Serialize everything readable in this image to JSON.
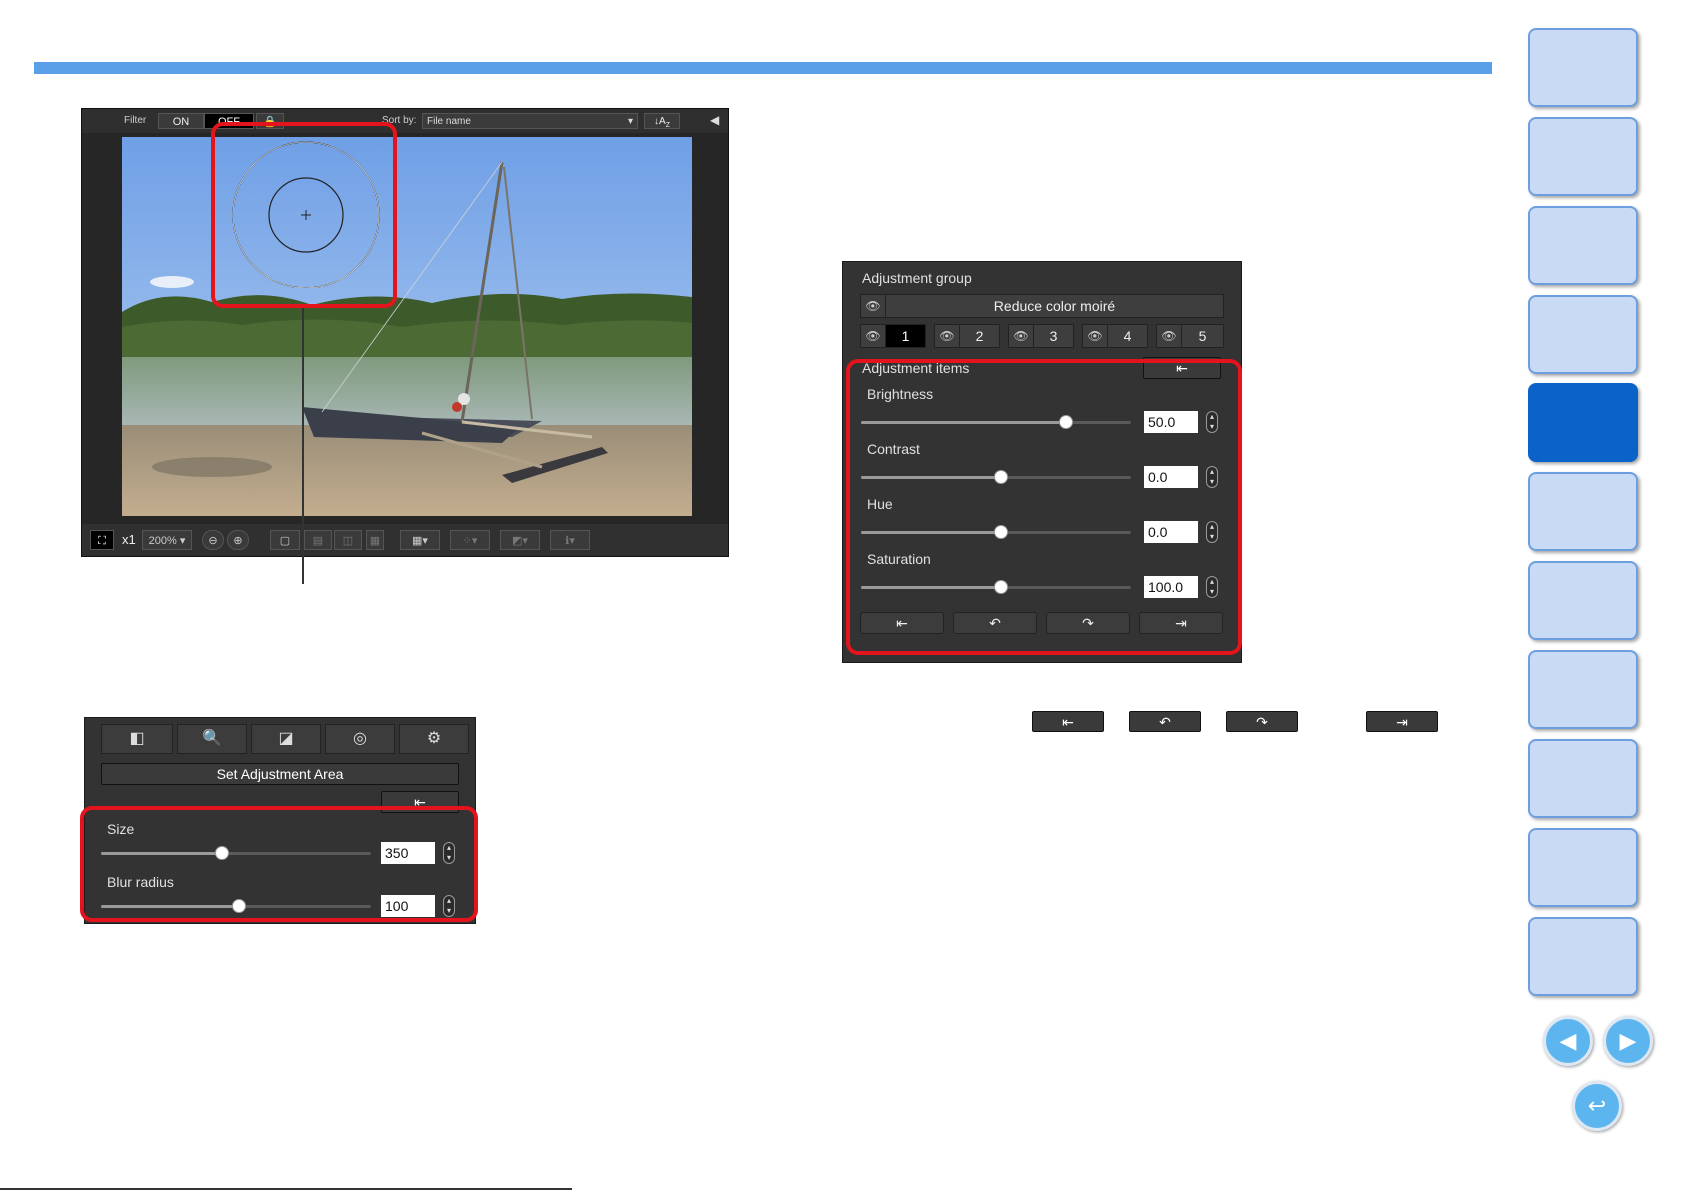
{
  "viewer": {
    "filter_label": "Filter",
    "on_label": "ON",
    "off_label": "OFF",
    "sortby_label": "Sort by:",
    "sort_value": "File name",
    "sort_az": "A",
    "sort_az_sub": "Z",
    "zoom_x1": "x1",
    "zoom_value": "200%"
  },
  "adjust_area_panel": {
    "set_area_button": "Set Adjustment Area",
    "size_label": "Size",
    "size_value": "350",
    "size_level": 0.4,
    "blur_label": "Blur radius",
    "blur_value": "100",
    "blur_level": 0.5
  },
  "adjust_group_panel": {
    "group_title": "Adjustment group",
    "reduce_moire_button": "Reduce color moiré",
    "groups": [
      "1",
      "2",
      "3",
      "4",
      "5"
    ],
    "selected_group": "1",
    "items_title": "Adjustment items",
    "brightness_label": "Brightness",
    "brightness_value": "50.0",
    "contrast_label": "Contrast",
    "contrast_value": "0.0",
    "hue_label": "Hue",
    "hue_value": "0.0",
    "saturation_label": "Saturation",
    "saturation_value": "100.0"
  },
  "navigation": {
    "tab_count": 11,
    "active_tab_index": 4
  },
  "colors": {
    "accent_blue": "#5aa0e8",
    "highlight_red": "#e3141b",
    "active_tab": "#0a63c9"
  }
}
